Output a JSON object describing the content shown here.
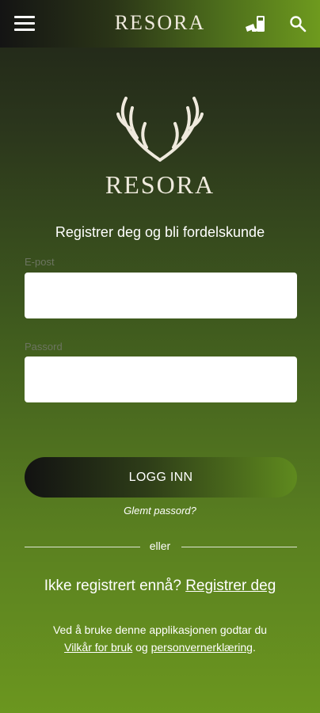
{
  "header": {
    "brand": "RESORA",
    "menu_icon": "hamburger-menu-icon",
    "cart_icon": "cart-icon",
    "search_icon": "search-icon"
  },
  "logo": {
    "icon": "antlers-logo-icon",
    "wordmark": "RESORA"
  },
  "form": {
    "headline": "Registrer deg og bli fordelskunde",
    "email": {
      "label": "E-post",
      "value": ""
    },
    "password": {
      "label": "Passord",
      "value": ""
    },
    "login_button": "LOGG INN",
    "forgot_password": "Glemt passord?",
    "divider_text": "eller"
  },
  "register": {
    "prompt": "Ikke registrert ennå?",
    "link": "Registrer deg"
  },
  "terms": {
    "text": "Ved å bruke denne applikasjonen godtar du",
    "terms_link": "Vilkår for bruk",
    "conjunction": "og",
    "privacy_link": "personvernerklæring",
    "end": "."
  },
  "colors": {
    "accent_green": "#6b961f",
    "dark": "#1f2418",
    "brand_text": "#efeadd"
  }
}
